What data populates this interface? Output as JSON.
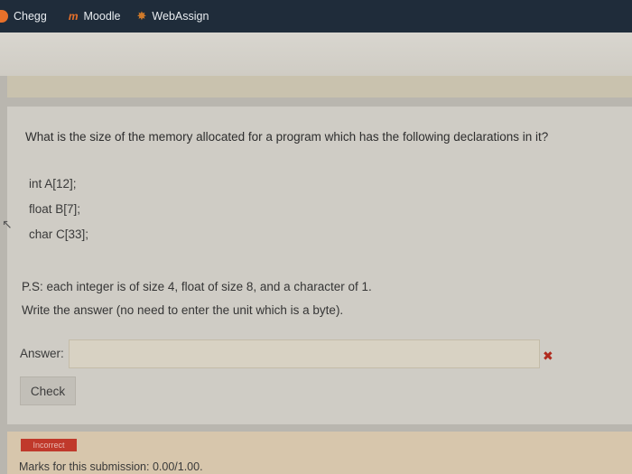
{
  "bookmarks": {
    "items": [
      {
        "label": "Chegg",
        "icon": "chegg-icon"
      },
      {
        "label": "Moodle",
        "icon": "moodle-icon"
      },
      {
        "label": "WebAssign",
        "icon": "webassign-icon"
      }
    ]
  },
  "question": {
    "text": "What is the size of the memory allocated for a program which has the following declarations in it?",
    "declarations": [
      "int A[12];",
      "float B[7];",
      "char C[33];"
    ],
    "note_line1": "P.S: each integer is of size 4, float of size 8, and a character of 1.",
    "note_line2": "Write the answer (no need to enter the unit which is a byte)."
  },
  "answer": {
    "label": "Answer:",
    "value": "",
    "status_icon": "cross-icon"
  },
  "check_button": {
    "label": "Check"
  },
  "feedback": {
    "badge": "Incorrect",
    "marks": "Marks for this submission: 0.00/1.00."
  },
  "colors": {
    "bookmark_bar": "#1f2c3a",
    "incorrect": "#c0392b",
    "accent_orange": "#e8712a"
  }
}
